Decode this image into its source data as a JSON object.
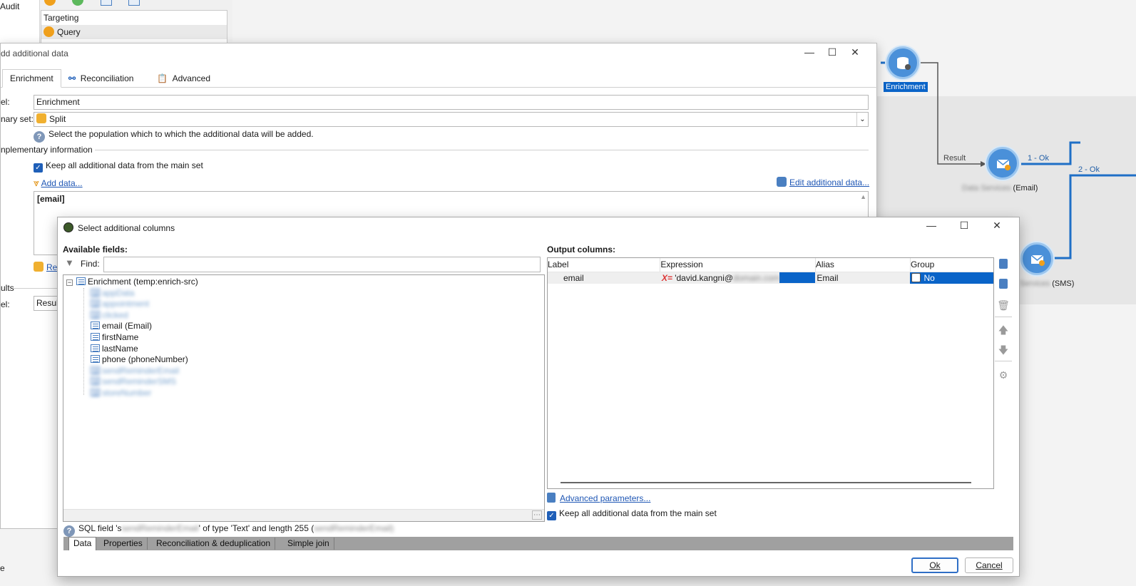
{
  "background": {
    "left_tree_label": "Audit",
    "targeting_list": {
      "header": "Targeting",
      "items": [
        {
          "label": "Query",
          "color": "#f0a01c"
        }
      ]
    },
    "workflow": {
      "nodes": [
        {
          "label": "Enrichment"
        },
        {
          "label": "(Email)",
          "blurred_prefix": "Data Services"
        },
        {
          "label": "(SMS)",
          "blurred_prefix": "Services"
        }
      ],
      "links": {
        "result": "Result",
        "ok1": "1 - Ok",
        "ok2": "2 - Ok"
      }
    }
  },
  "dialog1": {
    "title": "dd additional data",
    "tabs": [
      {
        "label": "Enrichment"
      },
      {
        "label": "Reconciliation"
      },
      {
        "label": "Advanced"
      }
    ],
    "label_caption": "el:",
    "label_value": "Enrichment",
    "primary_set_caption": "nary set:",
    "primary_set_value": "Split",
    "help_text": "Select the population which to which the additional data will be added.",
    "section_title": "nplementary information",
    "keep_all_label": "Keep all additional data from the main set",
    "add_data_link": "Add data...",
    "edit_additional_link": "Edit additional data...",
    "email_box_text": "[email]",
    "re_link": "Re",
    "results_caption": "ults",
    "result_label_caption": "el:",
    "result_value": "Result",
    "status_left": "e"
  },
  "dialog2": {
    "title": "Select additional columns",
    "available_fields_title": "Available fields:",
    "find_label": "Find:",
    "find_value": "",
    "tree_root": "Enrichment (temp:enrich-src)",
    "tree_items": [
      {
        "label": "appData",
        "blurred": true
      },
      {
        "label": "appointment",
        "blurred": true
      },
      {
        "label": "clicked",
        "blurred": true
      },
      {
        "label": "email (Email)",
        "blurred": false
      },
      {
        "label": "firstName",
        "blurred": false
      },
      {
        "label": "lastName",
        "blurred": false
      },
      {
        "label": "phone (phoneNumber)",
        "blurred": false
      },
      {
        "label": "sendReminderEmail",
        "blurred": true
      },
      {
        "label": "sendReminderSMS",
        "blurred": true
      },
      {
        "label": "storeNumber",
        "blurred": true
      }
    ],
    "output_columns_title": "Output columns:",
    "output_headers": {
      "label": "Label",
      "expression": "Expression",
      "alias": "Alias",
      "group": "Group"
    },
    "output_rows": [
      {
        "label": "email",
        "expression_prefix": "'david.kangni@",
        "expression_blurred": "domain.com",
        "alias": "Email",
        "group": "No"
      }
    ],
    "advanced_parameters_link": "Advanced parameters...",
    "keep_all_label": "Keep all additional data from the main set",
    "sql_field_text_prefix": "SQL field 's",
    "sql_field_blurred": "sendReminderEmail",
    "sql_field_text_mid": "' of type 'Text' and length 255 (",
    "sql_field_blurred2": "sendReminderEmail)",
    "bottom_tabs": [
      {
        "label": "Data"
      },
      {
        "label": "Properties"
      },
      {
        "label": "Reconciliation & deduplication"
      },
      {
        "label": "Simple join"
      }
    ],
    "ok_label": "Ok",
    "cancel_label": "Cancel"
  },
  "colors": {
    "accent": "#1f5fb8",
    "node_blue": "#4a90d9",
    "selection": "#0a64c8"
  }
}
